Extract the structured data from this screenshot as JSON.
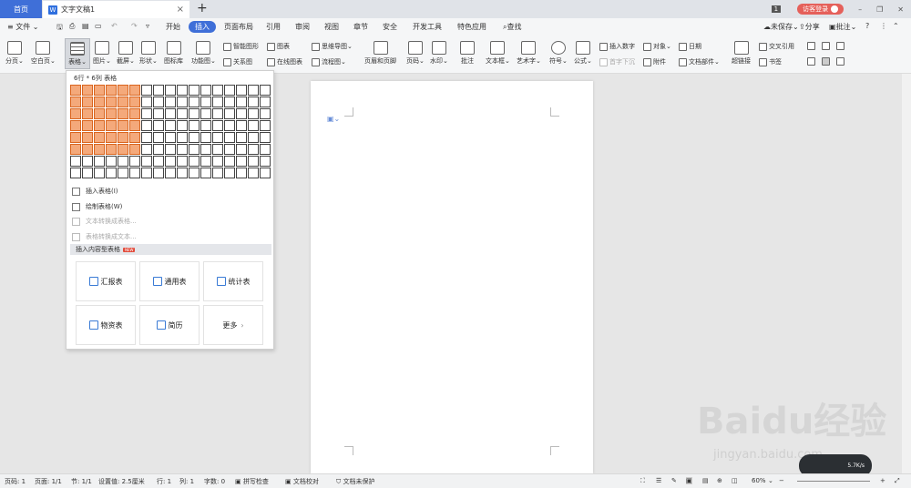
{
  "tabs": {
    "home": "首页",
    "doc": "文字文稿1",
    "new_tab": "+"
  },
  "titlebar": {
    "login": "访客登录",
    "page_count": "1"
  },
  "menu": {
    "file": "文件",
    "items": [
      "开始",
      "插入",
      "页面布局",
      "引用",
      "审阅",
      "视图",
      "章节",
      "安全",
      "开发工具",
      "特色应用"
    ],
    "search": "查找",
    "unsaved": "未保存",
    "share": "分享",
    "comment": "批注"
  },
  "ribbon": {
    "page_break": "分页",
    "blank_page": "空白页",
    "table": "表格",
    "picture": "图片",
    "screenshot": "截屏",
    "shape": "形状",
    "icon_lib": "图标库",
    "function_chart": "功能图",
    "smart_shape": "智能图形",
    "chart": "图表",
    "mind_map": "思维导图",
    "relation": "关系图",
    "online_chart": "在线图表",
    "flowchart": "流程图",
    "header_footer": "页眉和页脚",
    "page_number": "页码",
    "watermark": "水印",
    "comment": "批注",
    "textbox": "文本框",
    "art_text": "艺术字",
    "symbol": "符号",
    "formula": "公式",
    "insert_number": "插入数字",
    "object": "对象",
    "date": "日期",
    "drop_cap": "首字下沉",
    "attachment": "附件",
    "doc_parts": "文档部件",
    "hyperlink": "超链接",
    "cross_ref": "交叉引用",
    "bookmark": "书签"
  },
  "table_dropdown": {
    "size_label": "6行 * 6列 表格",
    "grid_rows": 8,
    "grid_cols": 17,
    "selected_rows": 6,
    "selected_cols": 6,
    "insert_table": "插入表格(I)",
    "draw_table": "绘制表格(W)",
    "text_to_table": "文本转换成表格...",
    "table_to_text": "表格转换成文本...",
    "content_table_header": "插入内容型表格",
    "new_badge": "NEW",
    "cards": [
      "汇报表",
      "通用表",
      "统计表",
      "物资表",
      "简历"
    ],
    "more": "更多"
  },
  "status": {
    "page_num": "页码: 1",
    "page": "页面: 1/1",
    "section": "节: 1/1",
    "setting": "设置值: 2.5厘米",
    "row": "行: 1",
    "col": "列: 1",
    "words": "字数: 0",
    "spell": "拼写检查",
    "proof": "文档校对",
    "protect": "文档未保护",
    "zoom": "60%"
  },
  "watermark": {
    "logo": "Baidu经验",
    "url": "jingyan.baidu.com"
  },
  "speed": {
    "value": "5.7",
    "unit": "K/s"
  },
  "colors": {
    "accent": "#3f6fd8",
    "grid_selected": "#f4a97b",
    "login_btn": "#e5605a"
  }
}
